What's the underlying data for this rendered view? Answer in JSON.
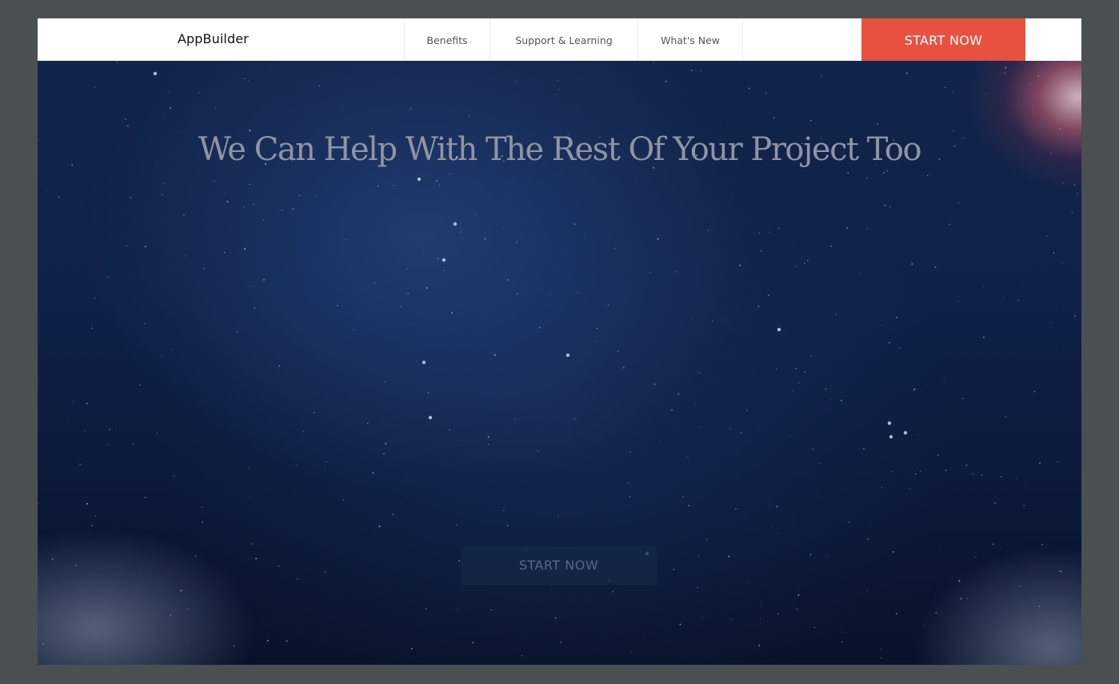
{
  "header": {
    "brand": "AppBuilder",
    "nav": [
      {
        "label": "Benefits"
      },
      {
        "label": "Support & Learning"
      },
      {
        "label": "What's New"
      }
    ],
    "cta_label": "START NOW"
  },
  "hero": {
    "headline": "We Can Help With The Rest Of Your Project Too",
    "cta_label": "START NOW"
  },
  "colors": {
    "accent": "#e85140",
    "page_background": "#4a4f52",
    "hero_background": "#0f2147"
  }
}
